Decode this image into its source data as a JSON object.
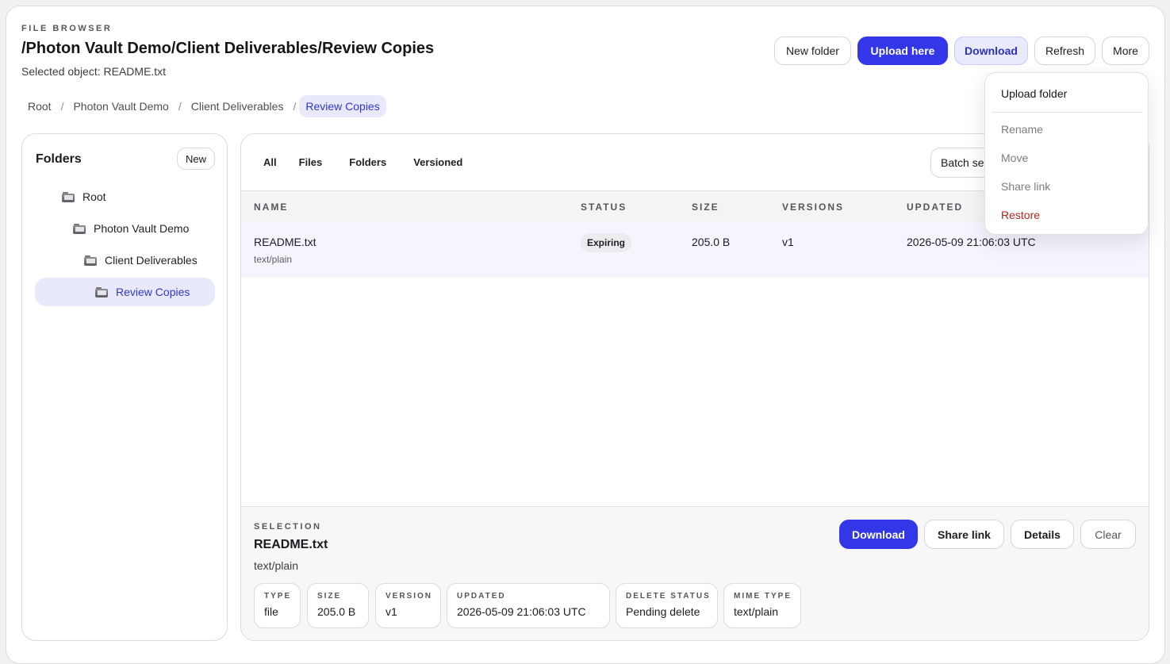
{
  "header": {
    "eyebrow": "FILE BROWSER",
    "title": "/Photon Vault Demo/Client Deliverables/Review Copies",
    "selected": "Selected object: README.txt"
  },
  "toolbar": {
    "new_folder": "New folder",
    "upload_here": "Upload here",
    "download": "Download",
    "refresh": "Refresh",
    "more": "More"
  },
  "breadcrumbs": [
    "Root",
    "Photon Vault Demo",
    "Client Deliverables",
    "Review Copies"
  ],
  "sidebar": {
    "title": "Folders",
    "new_label": "New",
    "items": [
      "Root",
      "Photon Vault Demo",
      "Client Deliverables",
      "Review Copies"
    ]
  },
  "filters": [
    "All",
    "Files",
    "Folders",
    "Versioned"
  ],
  "batch_label": "Batch se",
  "table": {
    "columns": [
      "NAME",
      "STATUS",
      "SIZE",
      "VERSIONS",
      "UPDATED"
    ],
    "rows": [
      {
        "name": "README.txt",
        "mime": "text/plain",
        "status": "Expiring",
        "size": "205.0 B",
        "versions": "v1",
        "updated": "2026-05-09 21:06:03 UTC"
      }
    ]
  },
  "selection": {
    "eyebrow": "SELECTION",
    "title": "README.txt",
    "subtitle": "text/plain",
    "buttons": {
      "download": "Download",
      "share": "Share link",
      "details": "Details",
      "clear": "Clear"
    },
    "chips": [
      {
        "label": "TYPE",
        "value": "file"
      },
      {
        "label": "SIZE",
        "value": "205.0 B"
      },
      {
        "label": "VERSION",
        "value": "v1"
      },
      {
        "label": "UPDATED",
        "value": "2026-05-09 21:06:03 UTC"
      },
      {
        "label": "DELETE STATUS",
        "value": "Pending delete"
      },
      {
        "label": "MIME TYPE",
        "value": "text/plain"
      }
    ]
  },
  "more_menu": {
    "items": [
      "Upload folder",
      "Rename",
      "Move",
      "Share link",
      "Restore"
    ]
  },
  "colors": {
    "accent": "#3437e8",
    "danger": "#b3261e",
    "selected_bg": "#e8e9fb"
  }
}
